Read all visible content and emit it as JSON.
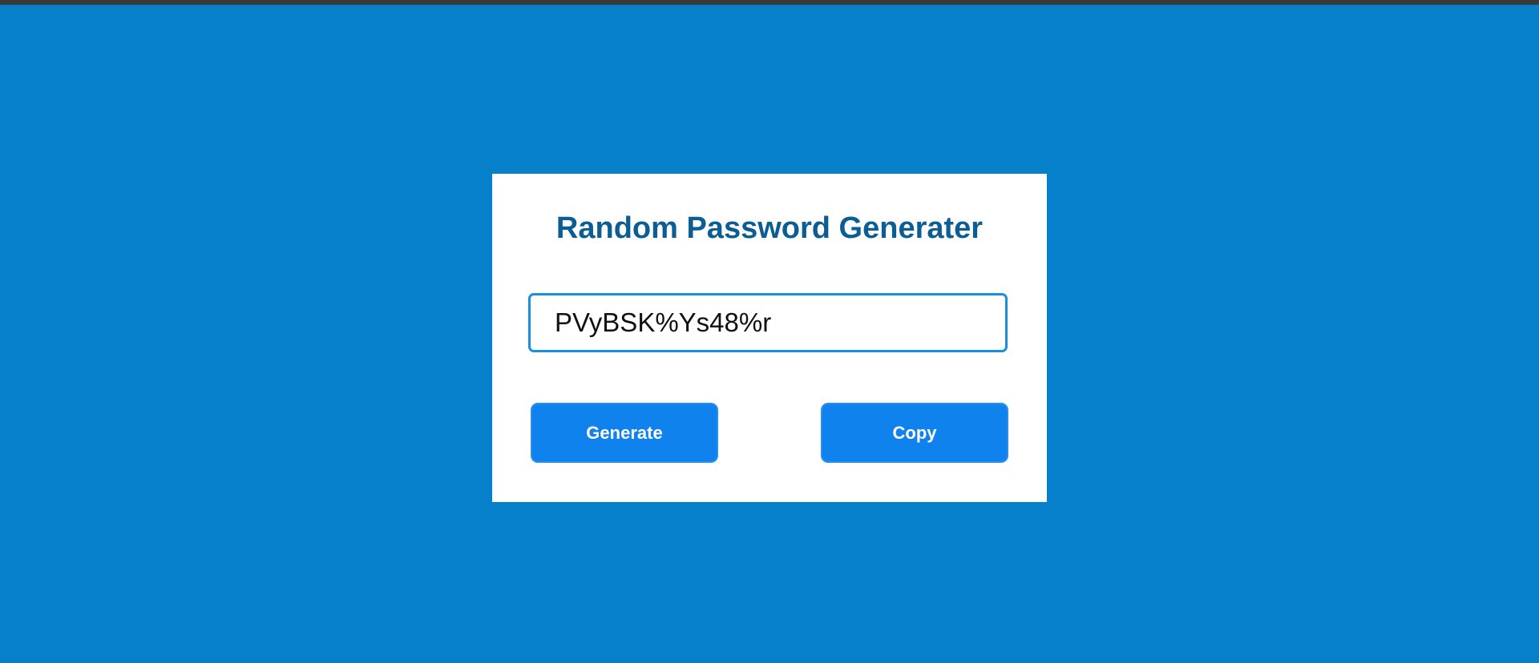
{
  "app": {
    "title": "Random Password Generater"
  },
  "password": {
    "value": "PVyBSK%Ys48%r"
  },
  "actions": {
    "generate_label": "Generate",
    "copy_label": "Copy"
  },
  "colors": {
    "page_background": "#0780cb",
    "card_background": "#ffffff",
    "title_text": "#0b5d94",
    "input_border": "#1a8fe0",
    "button_background": "#1082ee",
    "button_text": "#ffffff"
  }
}
